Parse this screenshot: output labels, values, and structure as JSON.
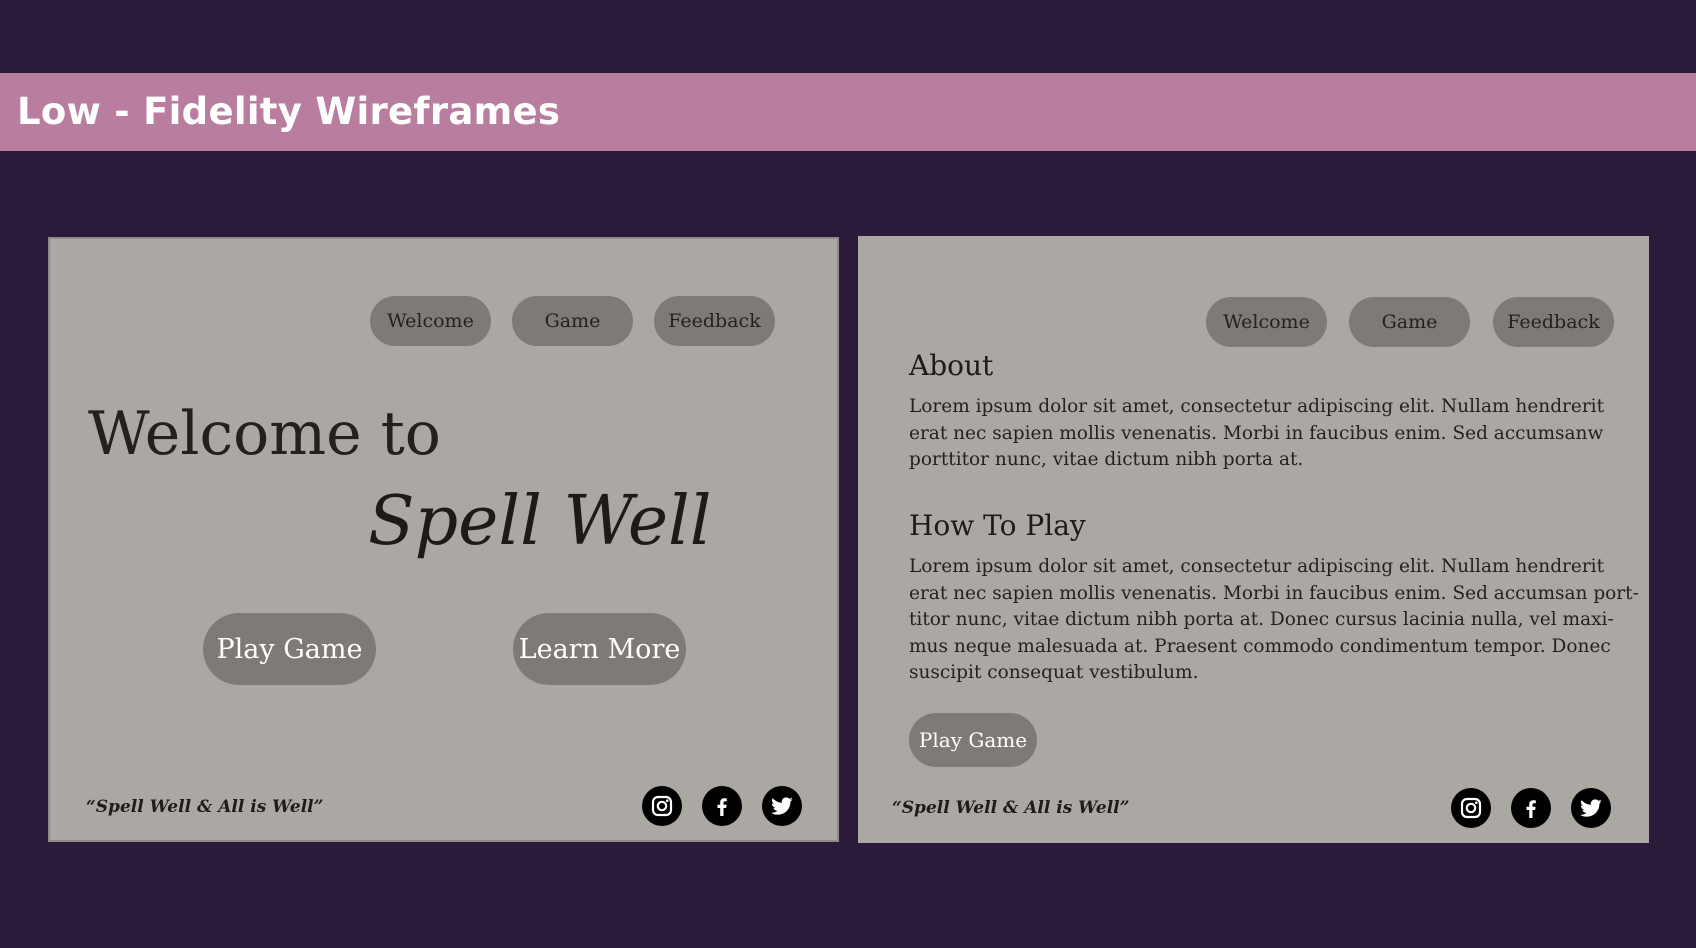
{
  "banner": {
    "title": "Low - Fidelity Wireframes"
  },
  "wireframe_welcome": {
    "nav": [
      "Welcome",
      "Game",
      "Feedback"
    ],
    "heading_line1": "Welcome to",
    "heading_line2": "Spell Well",
    "buttons": {
      "play": "Play Game",
      "learn": "Learn More"
    },
    "tagline": "“Spell Well & All is Well”",
    "socials": [
      "instagram-icon",
      "facebook-icon",
      "twitter-icon"
    ]
  },
  "wireframe_about": {
    "nav": [
      "Welcome",
      "Game",
      "Feedback"
    ],
    "about_title": "About",
    "about_lines": [
      "Lorem ipsum dolor sit amet, consectetur adipiscing elit. Nullam hendrerit",
      "erat nec sapien mollis venenatis. Morbi in faucibus enim. Sed accumsanw",
      "porttitor nunc, vitae dictum nibh porta at."
    ],
    "howto_title": "How To Play",
    "howto_lines": [
      "Lorem ipsum dolor sit amet, consectetur adipiscing elit. Nullam hendrerit",
      "erat nec sapien mollis venenatis. Morbi in faucibus enim. Sed accumsan port-",
      "titor nunc, vitae dictum nibh porta at. Donec cursus lacinia nulla, vel maxi-",
      "mus neque malesuada at. Praesent commodo condimentum tempor. Donec",
      "suscipit consequat vestibulum."
    ],
    "play_button": "Play Game",
    "tagline": "“Spell Well & All is Well”",
    "socials": [
      "instagram-icon",
      "facebook-icon",
      "twitter-icon"
    ]
  },
  "colors": {
    "background": "#2b1b3b",
    "banner": "#b97e9f",
    "frame": "#aba7a3",
    "pill": "#7f7a76"
  }
}
